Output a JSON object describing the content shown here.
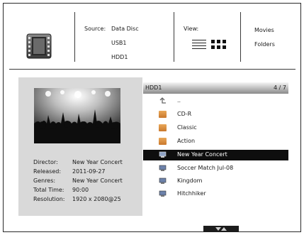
{
  "header": {
    "source_label": "Source:",
    "sources": [
      "Data Disc",
      "USB1",
      "HDD1"
    ],
    "view_label": "View:",
    "modes": [
      "Movies",
      "Folders"
    ]
  },
  "info": {
    "director_label": "Director:",
    "director": "New Year Concert",
    "released_label": "Released:",
    "released": "2011-09-27",
    "genres_label": "Genres:",
    "genres": "New Year Concert",
    "total_time_label": "Total Time:",
    "total_time": "90:00",
    "resolution_label": "Resolution:",
    "resolution": "1920 x 2080@25"
  },
  "list": {
    "title": "HDD1",
    "page": "4 / 7",
    "items": [
      {
        "label": "..",
        "icon": "back-arrow-icon"
      },
      {
        "label": "CD-R",
        "icon": "folder-icon"
      },
      {
        "label": "Classic",
        "icon": "folder-icon"
      },
      {
        "label": "Action",
        "icon": "folder-icon"
      },
      {
        "label": "New Year Concert",
        "icon": "video-file-icon",
        "selected": true
      },
      {
        "label": "Soccer Match Jul-08",
        "icon": "video-file-icon"
      },
      {
        "label": "Kingdom",
        "icon": "video-file-icon"
      },
      {
        "label": "Hitchhiker",
        "icon": "video-file-icon"
      }
    ]
  },
  "colors": {
    "selected_row": "#0e0e0e",
    "info_panel": "#d9d9d9",
    "folder": "#d88e3f"
  }
}
